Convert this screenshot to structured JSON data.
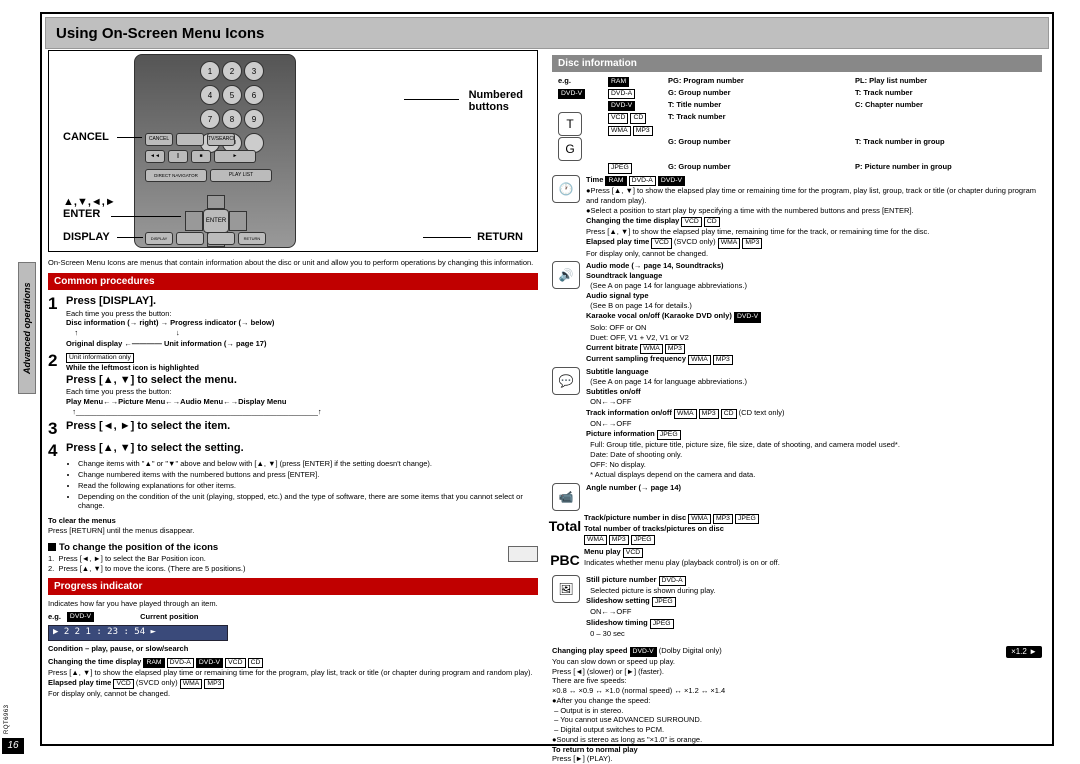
{
  "page_number": "16",
  "doc_ref": "RQT6963",
  "sidebar": "Advanced operations",
  "title": "Using On-Screen Menu Icons",
  "remote": {
    "numbered_label": "Numbered\nbuttons",
    "cancel": "CANCEL",
    "arrows_enter": "▲,▼,◄,►\nENTER",
    "display": "DISPLAY",
    "return": "RETURN",
    "btn_enter": "ENTER"
  },
  "intro": "On-Screen Menu Icons are menus that contain information about the disc or unit and allow you to perform operations by changing this information.",
  "sections": {
    "common": "Common procedures",
    "progress": "Progress indicator",
    "disc": "Disc information"
  },
  "step1": {
    "head": "Press [DISPLAY].",
    "sub": "Each time you press the button:",
    "flow1a": "Disc information (→ right)",
    "flow1b": "Progress indicator (→ below)",
    "flow2a": "Original display",
    "flow2b": "Unit information (→ page 17)"
  },
  "step2": {
    "box": "Unit information only",
    "bold_line": "While the leftmost icon is highlighted",
    "head": "Press [▲, ▼] to select the menu.",
    "sub": "Each time you press the button:",
    "flow": "Play Menu←→Picture Menu←→Audio Menu←→Display Menu"
  },
  "step3_head": "Press [◄, ►] to select the item.",
  "step4": {
    "head": "Press [▲, ▼] to select the setting.",
    "b1": "Change items with \"▲\" or \"▼\" above and below with [▲, ▼] (press [ENTER] if the setting doesn't change).",
    "b2": "Change numbered items with the numbered buttons and press [ENTER].",
    "b3": "Read the following explanations for other items.",
    "b4": "Depending on the condition of the unit (playing, stopped, etc.) and the type of software, there are some items that you cannot select or change."
  },
  "clear": {
    "h": "To clear the menus",
    "b": "Press [RETURN] until the menus disappear."
  },
  "change_pos": {
    "h": "To change the position of the icons",
    "l1": "Press [◄, ►] to select the Bar Position icon.",
    "l2": "Press [▲, ▼] to move the icons. (There are 5 positions.)"
  },
  "progress": {
    "intro": "Indicates how far you have played through an item.",
    "eg": "e.g.",
    "cur_pos": "Current position",
    "bar": "▶ 2 2   1 : 23 : 54 ►",
    "cond": "Condition – play, pause, or slow/search",
    "chg_h": "Changing the time display",
    "chg_b": "Press [▲, ▼] to show the elapsed play time or remaining time for the program, play list, track or title (or chapter during program and random play).",
    "elapsed_h": "Elapsed play time",
    "elapsed_b": "For display only, cannot be changed.",
    "svcd": "(SVCD only)",
    "speed_h": "Changing play speed",
    "speed_note": "(Dolby Digital only)",
    "speed_b1": "You can slow down or speed up play.",
    "speed_b2": "Press [◄] (slower) or [►] (faster).",
    "speed_b3": "There are five speeds:",
    "speed_list": "×0.8 ↔ ×0.9 ↔ ×1.0 (normal speed) ↔ ×1.2 ↔ ×1.4",
    "speed_badge": "×1.2 ►",
    "after_h": "After you change the speed:",
    "after_1": "Output is in stereo.",
    "after_2": "You cannot use ADVANCED SURROUND.",
    "after_3": "Digital output switches to PCM.",
    "after_4": "Sound is stereo as long as \"×1.0\" is orange.",
    "return_h": "To return to normal play",
    "return_b": "Press [►] (PLAY)."
  },
  "disc": {
    "eg": "e.g.",
    "r1a": "PG: Program number",
    "r1b": "PL: Play list number",
    "r2a": "G: Group number",
    "r2b": "T: Track number",
    "r3a": "T: Title number",
    "r3b": "C: Chapter number",
    "r4": "T: Track number",
    "r5a": "G: Group number",
    "r5b": "T: Track number in group",
    "r6a": "G: Group number",
    "r6b": "P: Picture number in group",
    "time_h": "Time",
    "time_b1": "Press [▲, ▼] to show the elapsed play time or remaining time for the program, play list, group, track or title (or chapter during program and random play).",
    "time_b2": "Select a position to start play by specifying a time with the numbered buttons and press [ENTER].",
    "chg_h": "Changing the time display",
    "chg_b": "Press [▲, ▼] to show the elapsed play time, remaining time for the track, or remaining time for the disc.",
    "el_h": "Elapsed play time",
    "el_b": "For display only, cannot be changed.",
    "svcd": "(SVCD only)",
    "audio_h": "Audio mode (→ page 14, Soundtracks)",
    "st_h": "Soundtrack language",
    "see_a": "(See A on page 14 for language abbreviations.)",
    "ast_h": "Audio signal type",
    "see_b": "(See B on page 14 for details.)",
    "kar_h": "Karaoke vocal on/off (Karaoke DVD only)",
    "kar_solo": "Solo: OFF or ON",
    "kar_duet": "Duet: OFF, V1 + V2, V1 or V2",
    "cb_h": "Current bitrate",
    "csf_h": "Current sampling frequency",
    "sub_h": "Subtitle language",
    "sub_on_h": "Subtitles on/off",
    "onoff": "ON←→OFF",
    "trk_h": "Track information on/off",
    "trk_note": "(CD text only)",
    "pic_h": "Picture information",
    "pic_full": "Full:  Group title, picture title, picture size, file size, date of shooting, and camera model used*.",
    "pic_date": "Date: Date of shooting only.",
    "pic_off": "OFF: No display.",
    "pic_foot": "* Actual displays depend on the camera and data.",
    "angle_h": "Angle number (→ page 14)",
    "total_lbl": "Total",
    "total_h1": "Track/picture number in disc",
    "total_h2": "Total number of tracks/pictures on disc",
    "pbc_lbl": "PBC",
    "pbc_h": "Menu play",
    "pbc_b": "Indicates whether menu play (playback control) is on or off.",
    "still_h": "Still picture number",
    "still_b": "Selected picture is shown during play.",
    "ss_h": "Slideshow setting",
    "st_h2": "Slideshow timing",
    "st_b": "0 – 30 sec"
  }
}
